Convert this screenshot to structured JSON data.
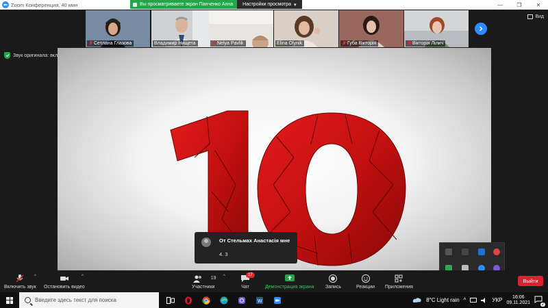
{
  "window": {
    "title": "Zoom Конференция, 40 мин",
    "minimize": "—",
    "maximize": "❐",
    "close": "✕"
  },
  "share_banner": {
    "status": "Вы просматриваете экран Панченко Анна",
    "options": "Настройки просмотра",
    "options_caret": "▾"
  },
  "gallery": {
    "participants": [
      {
        "name": "Сетлана Глазова",
        "muted": true
      },
      {
        "name": "Владимир Нищета",
        "muted": false
      },
      {
        "name": "Nelya Pavlik",
        "muted": true
      },
      {
        "name": "Elina Olynik",
        "muted": false
      },
      {
        "name": "Губа Вікторія",
        "muted": true
      },
      {
        "name": "Вікторія Лілич",
        "muted": true
      }
    ],
    "view_label": "Вид"
  },
  "audio": {
    "label": "Звук оригинала: вкл.",
    "caret": "▾"
  },
  "shared_screen": {
    "content_number": "10"
  },
  "chat_popup": {
    "from": "От Стельмах Анастасія мне",
    "message": "4. 3"
  },
  "toolbar": {
    "unmute": "Включить звук",
    "stop_video": "Остановить видео",
    "participants": "Участники",
    "participants_count": "19",
    "chat": "Чат",
    "chat_badge": "17",
    "share": "Демонстрация экрана",
    "record": "Запись",
    "reactions": "Реакции",
    "apps": "Приложения",
    "leave": "Выйти",
    "caret": "^"
  },
  "taskbar": {
    "search_placeholder": "Введите здесь текст для поиска",
    "weather": "8°C  Light rain",
    "language": "УКР",
    "time": "16:06",
    "date": "09.11.2021",
    "tray_caret": "^",
    "notification_count": "2"
  },
  "colors": {
    "zoom_blue": "#2d8cff",
    "share_green": "#23a54a",
    "leave_red": "#d9232e",
    "badge_red": "#e02828",
    "number_red": "#c41010"
  }
}
